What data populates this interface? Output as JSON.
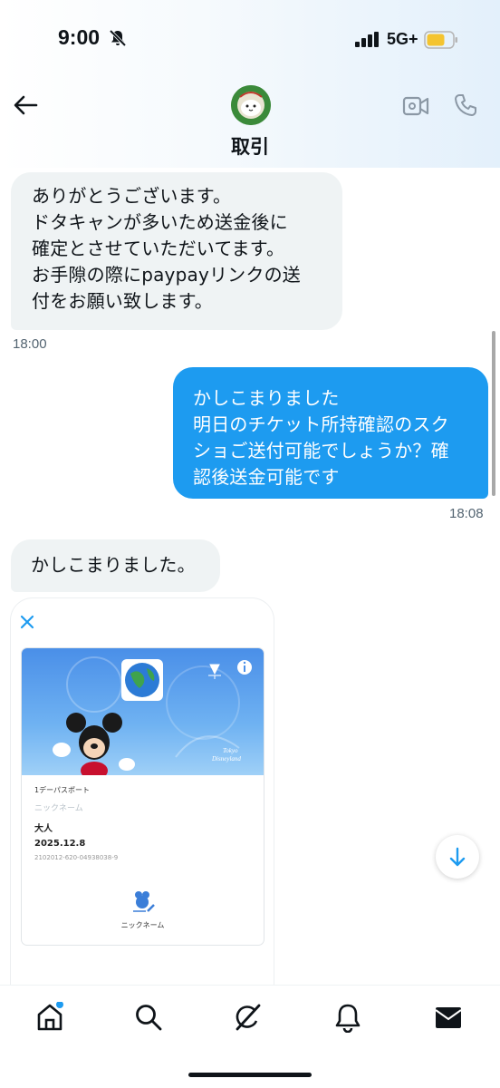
{
  "status_bar": {
    "time": "9:00",
    "network": "5G+",
    "icons": [
      "bell-slash-icon",
      "signal-icon",
      "battery-icon"
    ]
  },
  "header": {
    "title": "取引",
    "icons": [
      "back-arrow-icon",
      "video-call-icon",
      "phone-icon"
    ]
  },
  "messages": [
    {
      "side": "received",
      "lines": [
        "ありがとうございます。",
        "ドタキャンが多いため送金後に",
        "確定とさせていただいてます。",
        "お手隙の際にpaypayリンクの送",
        "付をお願い致します。"
      ],
      "time": "18:00"
    },
    {
      "side": "sent",
      "lines": [
        "かしこまりました",
        "明日のチケット所持確認のスク",
        "ショご送付可能でしょうか？確",
        "認後送金可能です"
      ],
      "time": "18:08"
    },
    {
      "side": "received",
      "lines": [
        "かしこまりました。"
      ]
    }
  ],
  "ticket_card": {
    "close_icon": "close-icon",
    "pass_type": "1デーパスポート",
    "nickname_placeholder": "ニックネーム",
    "ticket_kind": "大人",
    "date": "2025.12.8",
    "ticket_id": "2102012-620-04938038-9",
    "nickname_button": "ニックネーム",
    "park_logo_line1": "Tokyo",
    "park_logo_line2": "Disneyland"
  },
  "tabs": [
    "home-icon",
    "search-icon",
    "grok-icon",
    "notifications-icon",
    "messages-icon"
  ],
  "colors": {
    "accent": "#1d9bf0",
    "received_bubble": "#eff3f4"
  }
}
